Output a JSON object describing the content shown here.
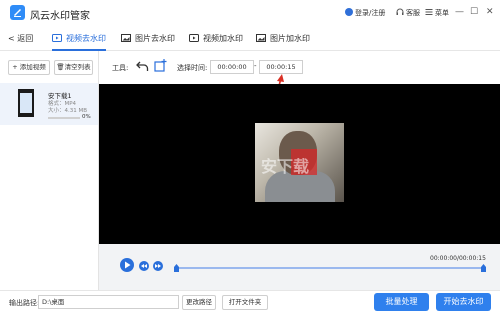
{
  "app": {
    "title": "风云水印管家"
  },
  "header": {
    "login": "登录/注册",
    "help": "客服",
    "menu": "菜单"
  },
  "window_controls": {
    "minimize": "—",
    "maximize": "☐",
    "close": "✕"
  },
  "nav": {
    "back": "返回",
    "tabs": [
      {
        "label": "视频去水印",
        "icon": "video-icon",
        "active": true
      },
      {
        "label": "图片去水印",
        "icon": "image-icon",
        "active": false
      },
      {
        "label": "视频加水印",
        "icon": "video-icon",
        "active": false
      },
      {
        "label": "图片加水印",
        "icon": "image-icon",
        "active": false
      }
    ]
  },
  "sidebar": {
    "add_video": "+ 添加视频",
    "clear_list": "清空列表",
    "file": {
      "name": "安下载1",
      "format": "格式：MP4",
      "size": "大小：4.31 MB",
      "progress_pct": "0%",
      "progress": 0
    }
  },
  "toolbar": {
    "label": "工具:",
    "time_label": "选择时间:",
    "start_time": "00:00:00",
    "dash": "-",
    "end_time": "00:00:15"
  },
  "player": {
    "timecode": "00:00:00/00:00:15",
    "watermark_text": "安下载"
  },
  "output": {
    "label": "输出路径:",
    "path": "D:\\桌面",
    "change_path": "更改路径",
    "open_folder": "打开文件夹",
    "batch": "批量处理",
    "start": "开始去水印"
  },
  "colors": {
    "accent": "#2a6fdb",
    "primary_button": "#2f80ed",
    "player_bg": "#000000",
    "arrow": "#d93025"
  }
}
